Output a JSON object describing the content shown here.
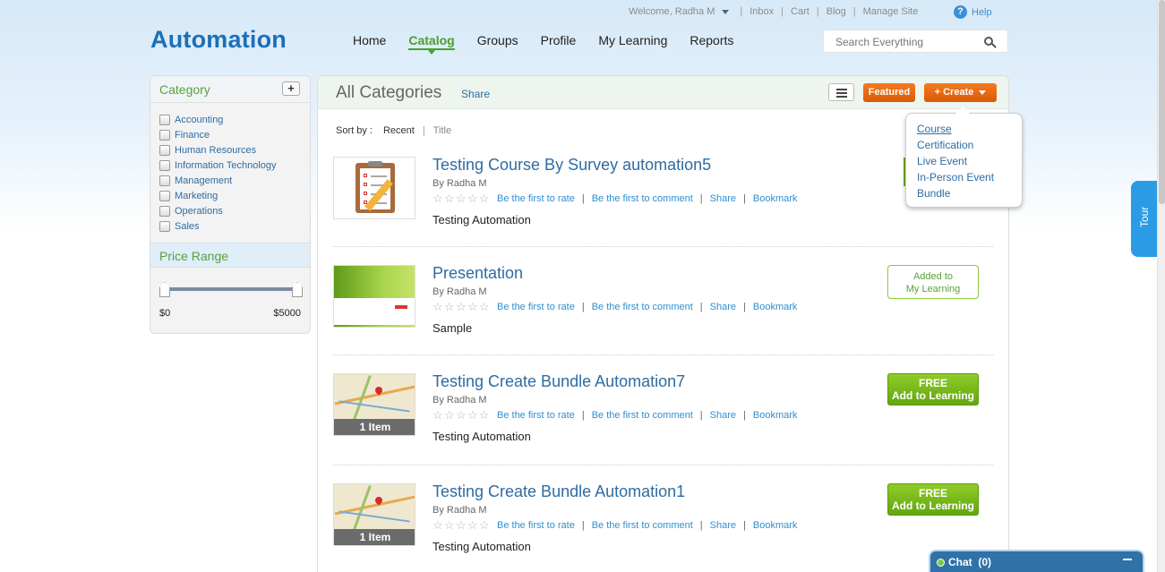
{
  "header": {
    "welcome": "Welcome, Radha M",
    "links": [
      "Inbox",
      "Cart",
      "Blog",
      "Manage Site"
    ],
    "help": "Help",
    "logo": "Automation",
    "nav": [
      "Home",
      "Catalog",
      "Groups",
      "Profile",
      "My Learning",
      "Reports"
    ],
    "active_nav": "Catalog",
    "search_placeholder": "Search Everything"
  },
  "sidebar": {
    "category_title": "Category",
    "add_label": "+",
    "categories": [
      "Accounting",
      "Finance",
      "Human Resources",
      "Information Technology",
      "Management",
      "Marketing",
      "Operations",
      "Sales"
    ],
    "price_title": "Price Range",
    "price_min": "$0",
    "price_max": "$5000"
  },
  "main": {
    "title": "All Categories",
    "share": "Share",
    "featured": "Featured",
    "create": "+ Create",
    "sort_label": "Sort by :",
    "sort_current": "Recent",
    "sort_alt": "Title"
  },
  "create_menu": [
    "Course",
    "Certification",
    "Live Event",
    "In-Person Event",
    "Bundle"
  ],
  "item_links": {
    "rate": "Be the first to rate",
    "comment": "Be the first to comment",
    "share": "Share",
    "bookmark": "Bookmark"
  },
  "items": [
    {
      "title": "Testing Course By Survey automation5",
      "by": "By Radha M",
      "desc": "Testing Automation",
      "thumb": "survey-clipboard"
    },
    {
      "title": "Presentation",
      "by": "By Radha M",
      "desc": "Sample",
      "action_line1": "Added to",
      "action_line2": "My Learning",
      "thumb": "presentation-slide"
    },
    {
      "title": "Testing Create Bundle Automation7",
      "by": "By Radha M",
      "desc": "Testing Automation",
      "action_line1": "FREE",
      "action_line2": "Add to Learning",
      "badge": "1 Item",
      "thumb": "map"
    },
    {
      "title": "Testing Create Bundle Automation1",
      "by": "By Radha M",
      "desc": "Testing Automation",
      "action_line1": "FREE",
      "action_line2": "Add to Learning",
      "badge": "1 Item",
      "thumb": "map"
    }
  ],
  "tour": "Tour",
  "chat": {
    "label": "Chat",
    "count": "(0)"
  },
  "colors": {
    "brand": "#1d6fb8",
    "accent_green": "#4aa02c",
    "orange": "#e8690f",
    "link": "#2e6ca3"
  }
}
